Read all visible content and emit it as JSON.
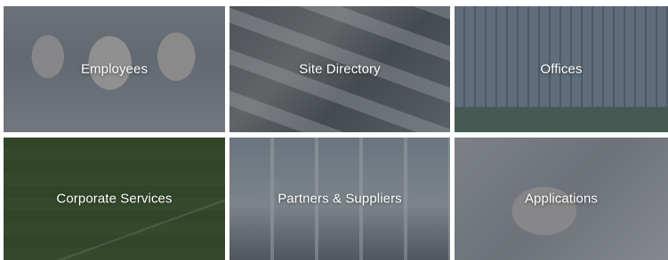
{
  "tiles": [
    {
      "label": "Employees"
    },
    {
      "label": "Site Directory"
    },
    {
      "label": "Offices"
    },
    {
      "label": "Corporate Services"
    },
    {
      "label": "Partners & Suppliers"
    },
    {
      "label": "Applications"
    }
  ]
}
